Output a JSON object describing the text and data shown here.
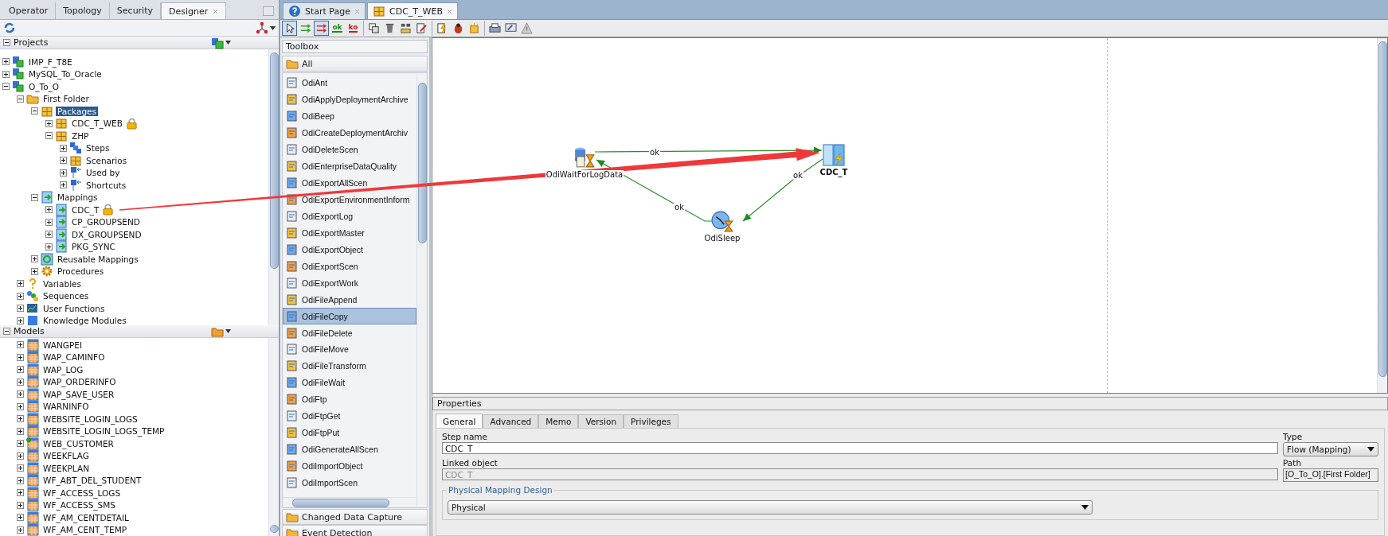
{
  "left_panel": {
    "tabs": [
      {
        "label": "Operator",
        "selected": false
      },
      {
        "label": "Topology",
        "selected": false
      },
      {
        "label": "Security",
        "selected": false
      },
      {
        "label": "Designer",
        "selected": true
      }
    ]
  },
  "projects": {
    "title": "Projects",
    "tree": [
      {
        "label": "IMP_F_T8E",
        "kind": "project",
        "expanded": false,
        "selected": false,
        "locked": false
      },
      {
        "label": "MySQL_To_Oracle",
        "kind": "project",
        "expanded": false,
        "selected": false,
        "locked": false
      },
      {
        "label": "O_To_O",
        "kind": "project",
        "expanded": true,
        "selected": false,
        "locked": false,
        "children": [
          {
            "label": "First Folder",
            "kind": "folder",
            "expanded": true,
            "selected": false,
            "locked": false,
            "children": [
              {
                "label": "Packages",
                "kind": "package",
                "expanded": true,
                "selected": true,
                "locked": false,
                "children": [
                  {
                    "label": "CDC_T_WEB",
                    "kind": "package",
                    "expanded": false,
                    "selected": false,
                    "locked": true
                  },
                  {
                    "label": "ZHP",
                    "kind": "package",
                    "expanded": true,
                    "selected": false,
                    "locked": false,
                    "children": [
                      {
                        "label": "Steps",
                        "kind": "steps",
                        "expanded": false,
                        "selected": false,
                        "locked": false
                      },
                      {
                        "label": "Scenarios",
                        "kind": "scenarios",
                        "expanded": false,
                        "selected": false,
                        "locked": false
                      },
                      {
                        "label": "Used by",
                        "kind": "reference",
                        "expanded": false,
                        "selected": false,
                        "locked": false
                      },
                      {
                        "label": "Shortcuts",
                        "kind": "reference",
                        "expanded": false,
                        "selected": false,
                        "locked": false
                      }
                    ]
                  }
                ]
              },
              {
                "label": "Mappings",
                "kind": "mapping",
                "expanded": true,
                "selected": false,
                "locked": false,
                "children": [
                  {
                    "label": "CDC_T",
                    "kind": "mapping",
                    "expanded": false,
                    "selected": false,
                    "locked": true
                  },
                  {
                    "label": "CP_GROUPSEND",
                    "kind": "mapping",
                    "expanded": false,
                    "selected": false,
                    "locked": false
                  },
                  {
                    "label": "DX_GROUPSEND",
                    "kind": "mapping",
                    "expanded": false,
                    "selected": false,
                    "locked": false
                  },
                  {
                    "label": "PKG_SYNC",
                    "kind": "mapping",
                    "expanded": false,
                    "selected": false,
                    "locked": false
                  }
                ]
              },
              {
                "label": "Reusable Mappings",
                "kind": "reusable",
                "expanded": false,
                "selected": false,
                "locked": false
              },
              {
                "label": "Procedures",
                "kind": "procedure",
                "expanded": false,
                "selected": false,
                "locked": false
              }
            ]
          },
          {
            "label": "Variables",
            "kind": "variable",
            "expanded": false,
            "selected": false,
            "locked": false
          },
          {
            "label": "Sequences",
            "kind": "sequence",
            "expanded": false,
            "selected": false,
            "locked": false
          },
          {
            "label": "User Functions",
            "kind": "function",
            "expanded": false,
            "selected": false,
            "locked": false
          },
          {
            "label": "Knowledge Modules",
            "kind": "module",
            "expanded": false,
            "selected": false,
            "locked": false
          }
        ]
      }
    ]
  },
  "models": {
    "title": "Models",
    "tree": [
      {
        "label": "WANGPEI",
        "expanded": false,
        "marked": false
      },
      {
        "label": "WAP_CAMINFO",
        "expanded": false,
        "marked": false
      },
      {
        "label": "WAP_LOG",
        "expanded": false,
        "marked": false
      },
      {
        "label": "WAP_ORDERINFO",
        "expanded": false,
        "marked": false
      },
      {
        "label": "WAP_SAVE_USER",
        "expanded": false,
        "marked": false
      },
      {
        "label": "WARNINFO",
        "expanded": false,
        "marked": false
      },
      {
        "label": "WEBSITE_LOGIN_LOGS",
        "expanded": false,
        "marked": false
      },
      {
        "label": "WEBSITE_LOGIN_LOGS_TEMP",
        "expanded": false,
        "marked": false
      },
      {
        "label": "WEB_CUSTOMER",
        "expanded": false,
        "marked": true
      },
      {
        "label": "WEEKFLAG",
        "expanded": false,
        "marked": false
      },
      {
        "label": "WEEKPLAN",
        "expanded": false,
        "marked": false
      },
      {
        "label": "WF_ABT_DEL_STUDENT",
        "expanded": false,
        "marked": false
      },
      {
        "label": "WF_ACCESS_LOGS",
        "expanded": false,
        "marked": false
      },
      {
        "label": "WF_ACCESS_SMS",
        "expanded": false,
        "marked": false
      },
      {
        "label": "WF_AM_CENTDETAIL",
        "expanded": false,
        "marked": false
      },
      {
        "label": "WF_AM_CENT_TEMP",
        "expanded": false,
        "marked": false
      }
    ]
  },
  "editor": {
    "tabs": [
      {
        "label": "Start Page",
        "kind": "start",
        "selected": false
      },
      {
        "label": "CDC_T_WEB",
        "kind": "package",
        "selected": true
      }
    ],
    "toolbar": [
      [
        {
          "kind": "pointer",
          "pressed": true
        },
        {
          "kind": "next",
          "pressed": false
        },
        {
          "kind": "flow",
          "pressed": true
        },
        {
          "kind": "ok",
          "label": "ok",
          "pressed": false
        },
        {
          "kind": "ko",
          "label": "ko",
          "pressed": false
        }
      ],
      [
        {
          "kind": "duplicate",
          "pressed": false
        },
        {
          "kind": "delete",
          "pressed": false
        },
        {
          "kind": "layout",
          "pressed": false
        },
        {
          "kind": "edit",
          "pressed": false
        }
      ],
      [
        {
          "kind": "execute",
          "pressed": false
        },
        {
          "kind": "debug",
          "pressed": false
        },
        {
          "kind": "sparkle",
          "pressed": false
        }
      ],
      [
        {
          "kind": "print",
          "pressed": false
        },
        {
          "kind": "screen",
          "pressed": false
        },
        {
          "kind": "warning",
          "pressed": false
        }
      ]
    ]
  },
  "toolbox": {
    "title": "Toolbox",
    "top_group": "All",
    "items": [
      {
        "label": "OdiAnt",
        "selected": false
      },
      {
        "label": "OdiApplyDeploymentArchive",
        "selected": false
      },
      {
        "label": "OdiBeep",
        "selected": false
      },
      {
        "label": "OdiCreateDeploymentArchiv",
        "selected": false
      },
      {
        "label": "OdiDeleteScen",
        "selected": false
      },
      {
        "label": "OdiEnterpriseDataQuality",
        "selected": false
      },
      {
        "label": "OdiExportAllScen",
        "selected": false
      },
      {
        "label": "OdiExportEnvironmentInform",
        "selected": false
      },
      {
        "label": "OdiExportLog",
        "selected": false
      },
      {
        "label": "OdiExportMaster",
        "selected": false
      },
      {
        "label": "OdiExportObject",
        "selected": false
      },
      {
        "label": "OdiExportScen",
        "selected": false
      },
      {
        "label": "OdiExportWork",
        "selected": false
      },
      {
        "label": "OdiFileAppend",
        "selected": false
      },
      {
        "label": "OdiFileCopy",
        "selected": true
      },
      {
        "label": "OdiFileDelete",
        "selected": false
      },
      {
        "label": "OdiFileMove",
        "selected": false
      },
      {
        "label": "OdiFileTransform",
        "selected": false
      },
      {
        "label": "OdiFileWait",
        "selected": false
      },
      {
        "label": "OdiFtp",
        "selected": false
      },
      {
        "label": "OdiFtpGet",
        "selected": false
      },
      {
        "label": "OdiFtpPut",
        "selected": false
      },
      {
        "label": "OdiGenerateAllScen",
        "selected": false
      },
      {
        "label": "OdiImportObject",
        "selected": false
      },
      {
        "label": "OdiImportScen",
        "selected": false
      }
    ],
    "groups": [
      "Changed Data Capture",
      "Event Detection"
    ]
  },
  "diagram": {
    "nodes": [
      {
        "label": "OdiWaitForLogData",
        "kind": "wait",
        "first_step": false
      },
      {
        "label": "CDC_T",
        "kind": "mapping",
        "first_step": true
      },
      {
        "label": "OdiSleep",
        "kind": "sleep",
        "first_step": false
      }
    ],
    "edges": [
      {
        "label": "ok"
      },
      {
        "label": "ok"
      },
      {
        "label": "ok"
      }
    ]
  },
  "properties": {
    "title": "Properties",
    "tabs": [
      {
        "label": "General",
        "selected": true
      },
      {
        "label": "Advanced",
        "selected": false
      },
      {
        "label": "Memo",
        "selected": false
      },
      {
        "label": "Version",
        "selected": false
      },
      {
        "label": "Privileges",
        "selected": false
      }
    ],
    "step_name": {
      "label": "Step name",
      "value": "CDC_T"
    },
    "type": {
      "label": "Type",
      "value": "Flow (Mapping)"
    },
    "linked_object": {
      "label": "Linked object",
      "value": "CDC_T",
      "disabled": true
    },
    "path": {
      "label": "Path",
      "value": "[O_To_O].[First Folder]"
    },
    "physical_design": {
      "legend": "Physical Mapping Design",
      "value": "Physical"
    }
  }
}
